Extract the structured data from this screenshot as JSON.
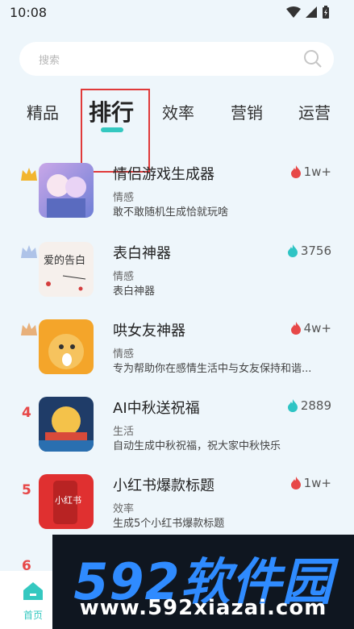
{
  "status_bar": {
    "time": "10:08"
  },
  "search": {
    "placeholder": "搜索"
  },
  "tabs": [
    {
      "label": "精品"
    },
    {
      "label": "排行"
    },
    {
      "label": "效率"
    },
    {
      "label": "营销"
    },
    {
      "label": "运营"
    }
  ],
  "items": [
    {
      "rank": "1",
      "title": "情侣游戏生成器",
      "category": "情感",
      "desc": "敢不敢随机生成恰就玩啥",
      "metric": "1w+",
      "metric_icon": "fire-red"
    },
    {
      "rank": "2",
      "title": "表白神器",
      "category": "情感",
      "desc": "表白神器",
      "metric": "3756",
      "metric_icon": "fire-teal"
    },
    {
      "rank": "3",
      "title": "哄女友神器",
      "category": "情感",
      "desc": "专为帮助你在感情生活中与女友保持和谐...",
      "metric": "4w+",
      "metric_icon": "fire-red"
    },
    {
      "rank": "4",
      "title": "AI中秋送祝福",
      "category": "生活",
      "desc": "自动生成中秋祝福，祝大家中秋快乐",
      "metric": "2889",
      "metric_icon": "fire-teal"
    },
    {
      "rank": "5",
      "title": "小红书爆款标题",
      "category": "效率",
      "desc": "生成5个小红书爆款标题",
      "metric": "1w+",
      "metric_icon": "fire-red"
    },
    {
      "rank": "6"
    }
  ],
  "thumb_texts": {
    "love": "爱的告白",
    "xhs": "小红书"
  },
  "bottom_nav": {
    "home_label": "首页"
  },
  "watermark": {
    "brand": "592软件园",
    "url": "www.592xiazai.com"
  },
  "colors": {
    "accent": "#34c8c0",
    "fire_red": "#e74848",
    "fire_teal": "#2ec4c4"
  }
}
